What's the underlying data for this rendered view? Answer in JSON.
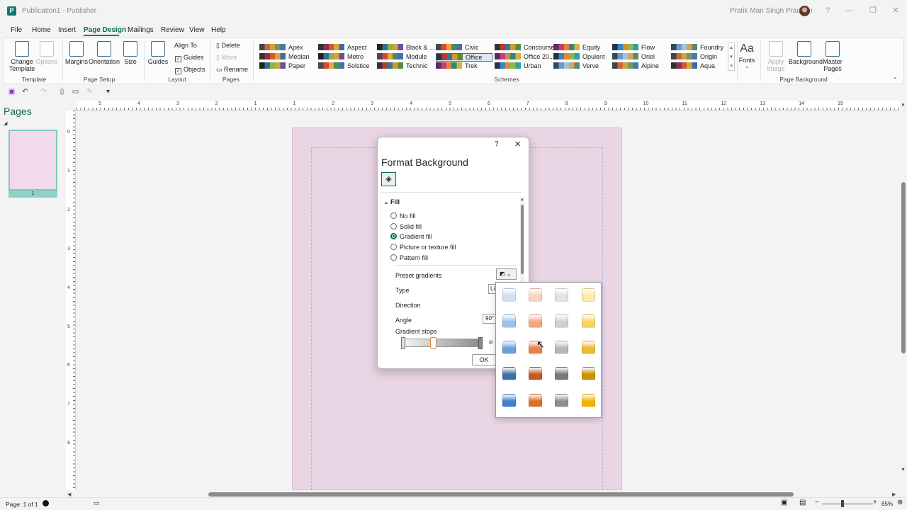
{
  "title_bar": {
    "title": "Publication1 - Publisher",
    "app_icon": "P",
    "user_name": "Pratik Man Singh Pradhan",
    "help": "?",
    "minimize": "—",
    "restore": "❐",
    "close": "✕"
  },
  "menu": [
    "File",
    "Home",
    "Insert",
    "Page Design",
    "Mailings",
    "Review",
    "View",
    "Help"
  ],
  "ribbon": {
    "template": {
      "change_template": "Change Template",
      "options": "Options",
      "group": "Template"
    },
    "page_setup": {
      "margins": "Margins",
      "orientation": "Orientation",
      "size": "Size",
      "group": "Page Setup"
    },
    "layout": {
      "guides": "Guides",
      "align_to": "Align To",
      "guides_check": "Guides",
      "objects_check": "Objects",
      "group": "Layout"
    },
    "pages": {
      "delete": "Delete",
      "move": "Move",
      "rename": "Rename",
      "group": "Pages"
    },
    "schemes": {
      "group": "Schemes",
      "items": [
        [
          "Apex",
          "Median",
          "Paper"
        ],
        [
          "Aspect",
          "Metro",
          "Solstice"
        ],
        [
          "Black & ...",
          "Module",
          "Technic"
        ],
        [
          "Civic",
          "Office",
          "Trek"
        ],
        [
          "Concourse",
          "Office 20...",
          "Urban"
        ],
        [
          "Equity",
          "Opulent",
          "Verve"
        ],
        [
          "Flow",
          "Oriel",
          "Alpine"
        ],
        [
          "Foundry",
          "Origin",
          "Aqua"
        ]
      ],
      "selected": "Office"
    },
    "fonts": {
      "label": "Fonts",
      "glyph": "Aa"
    },
    "page_background": {
      "apply_image": "Apply Image",
      "background": "Background",
      "master_pages": "Master Pages",
      "group": "Page Background"
    }
  },
  "pages_panel": {
    "title": "Pages",
    "thumb_number": "1"
  },
  "hruler_numbers": [
    "5",
    "4",
    "3",
    "2",
    "1",
    "1",
    "2",
    "3",
    "4",
    "5",
    "6",
    "7",
    "8",
    "9",
    "10",
    "11",
    "12",
    "13",
    "14",
    "15"
  ],
  "vruler_numbers": [
    "0",
    "1",
    "2",
    "3",
    "4",
    "5",
    "6",
    "7",
    "8"
  ],
  "dialog": {
    "title": "Format Background",
    "help": "?",
    "close": "✕",
    "section": "Fill",
    "fill_options": [
      "No fill",
      "Solid fill",
      "Gradient fill",
      "Picture or texture fill",
      "Pattern fill"
    ],
    "selected_fill": "Gradient fill",
    "preset_gradients": "Preset gradients",
    "type": "Type",
    "type_value": "Li",
    "direction": "Direction",
    "angle": "Angle",
    "angle_value": "90°",
    "gradient_stops": "Gradient stops",
    "ok": "OK"
  },
  "gallery_colors": [
    [
      "#cfe0f5",
      "#f9d3c0",
      "#e3e3e3",
      "#fde9a8"
    ],
    [
      "#9cc0ea",
      "#f3a882",
      "#cfcfcf",
      "#f8d45c"
    ],
    [
      "#6a9fd9",
      "#e8804d",
      "#b6b6b6",
      "#eebb2b"
    ],
    [
      "#3c6ea8",
      "#c65a24",
      "#7a7a7a",
      "#c99400"
    ],
    [
      "#3f7fcd",
      "#e06f27",
      "#8d8d8d",
      "#f0b400"
    ]
  ],
  "status_bar": {
    "page": "Page: 1 of 1",
    "zoom": "85%"
  }
}
